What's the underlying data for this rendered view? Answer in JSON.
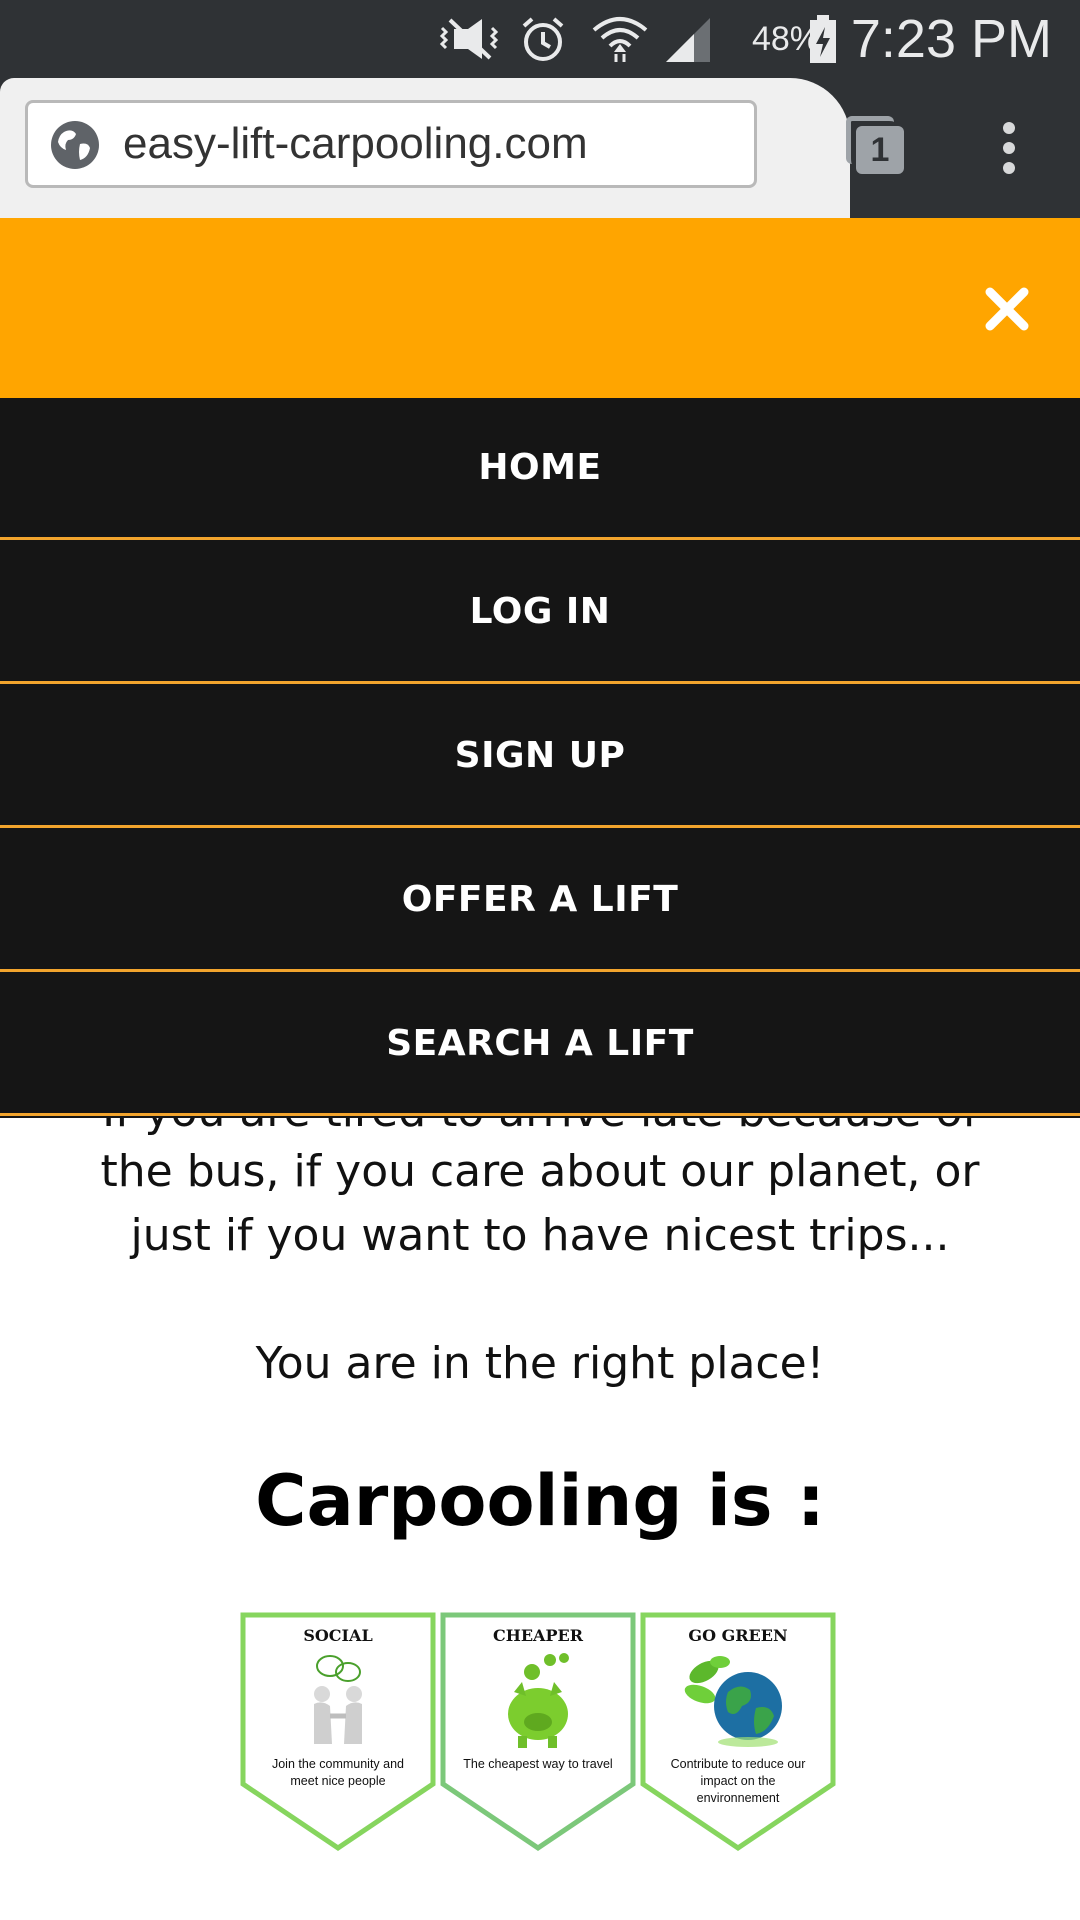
{
  "status_bar": {
    "battery_percent": "48%",
    "time": "7:23 PM",
    "icons": [
      "mute-vibrate-icon",
      "alarm-icon",
      "wifi-icon",
      "signal-icon",
      "battery-charging-icon"
    ]
  },
  "browser": {
    "url": "easy-lift-carpooling.com",
    "tab_count": "1"
  },
  "colors": {
    "header_orange": "#ffa500",
    "menu_background": "#151515",
    "menu_divider": "#f2a42d",
    "badge_border": "#86d55e"
  },
  "nav": {
    "items": [
      {
        "label": "HOME"
      },
      {
        "label": "LOG IN"
      },
      {
        "label": "SIGN UP"
      },
      {
        "label": "OFFER A LIFT"
      },
      {
        "label": "SEARCH A LIFT"
      }
    ]
  },
  "content": {
    "partial_line": "If you are tired to arrive late because of",
    "intro_line_1": "the bus, if you care about our planet, or",
    "intro_line_2": "just if you want to have nicest trips...",
    "right_place": "You are in the right place!",
    "heading": "Carpooling is :"
  },
  "badges": [
    {
      "title": "SOCIAL",
      "text": "Join the community and meet nice people",
      "icon": "handshake-icon"
    },
    {
      "title": "CHEAPER",
      "text": "The cheapest way to travel",
      "icon": "piggy-bank-icon"
    },
    {
      "title": "GO GREEN",
      "text": "Contribute to reduce our impact on the environnement",
      "icon": "globe-leaves-icon"
    }
  ]
}
